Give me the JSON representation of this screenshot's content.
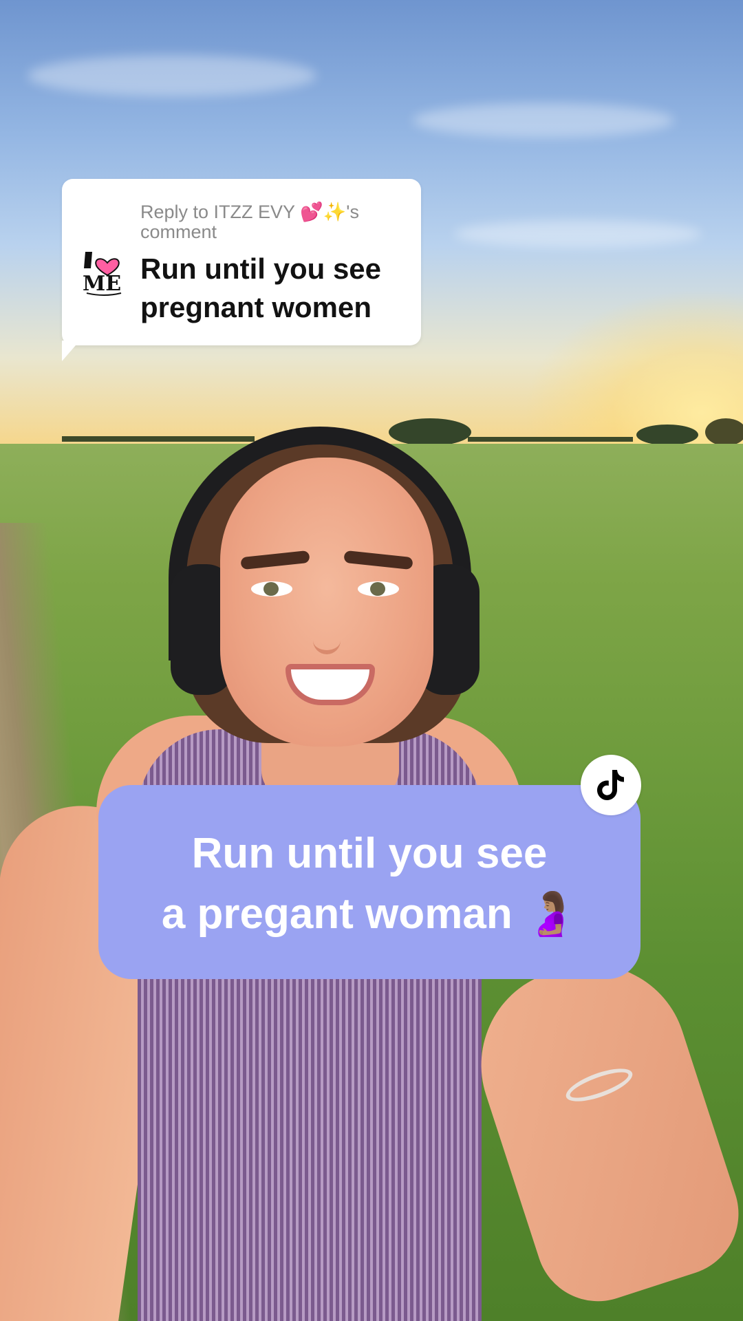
{
  "reply": {
    "label": "Reply to ITZZ EVY 💕✨'s comment",
    "text": "Run until you see pregnant women"
  },
  "caption": {
    "line1": "Run until you see",
    "line2": "a pregant woman",
    "emoji": "🤰🏽"
  },
  "badge": {
    "icon": "tiktok-icon",
    "color": "#000000"
  },
  "colors": {
    "caption_bubble": "#9aa3f2",
    "reply_card": "#ffffff",
    "logo_heart": "#ff5fa2"
  }
}
